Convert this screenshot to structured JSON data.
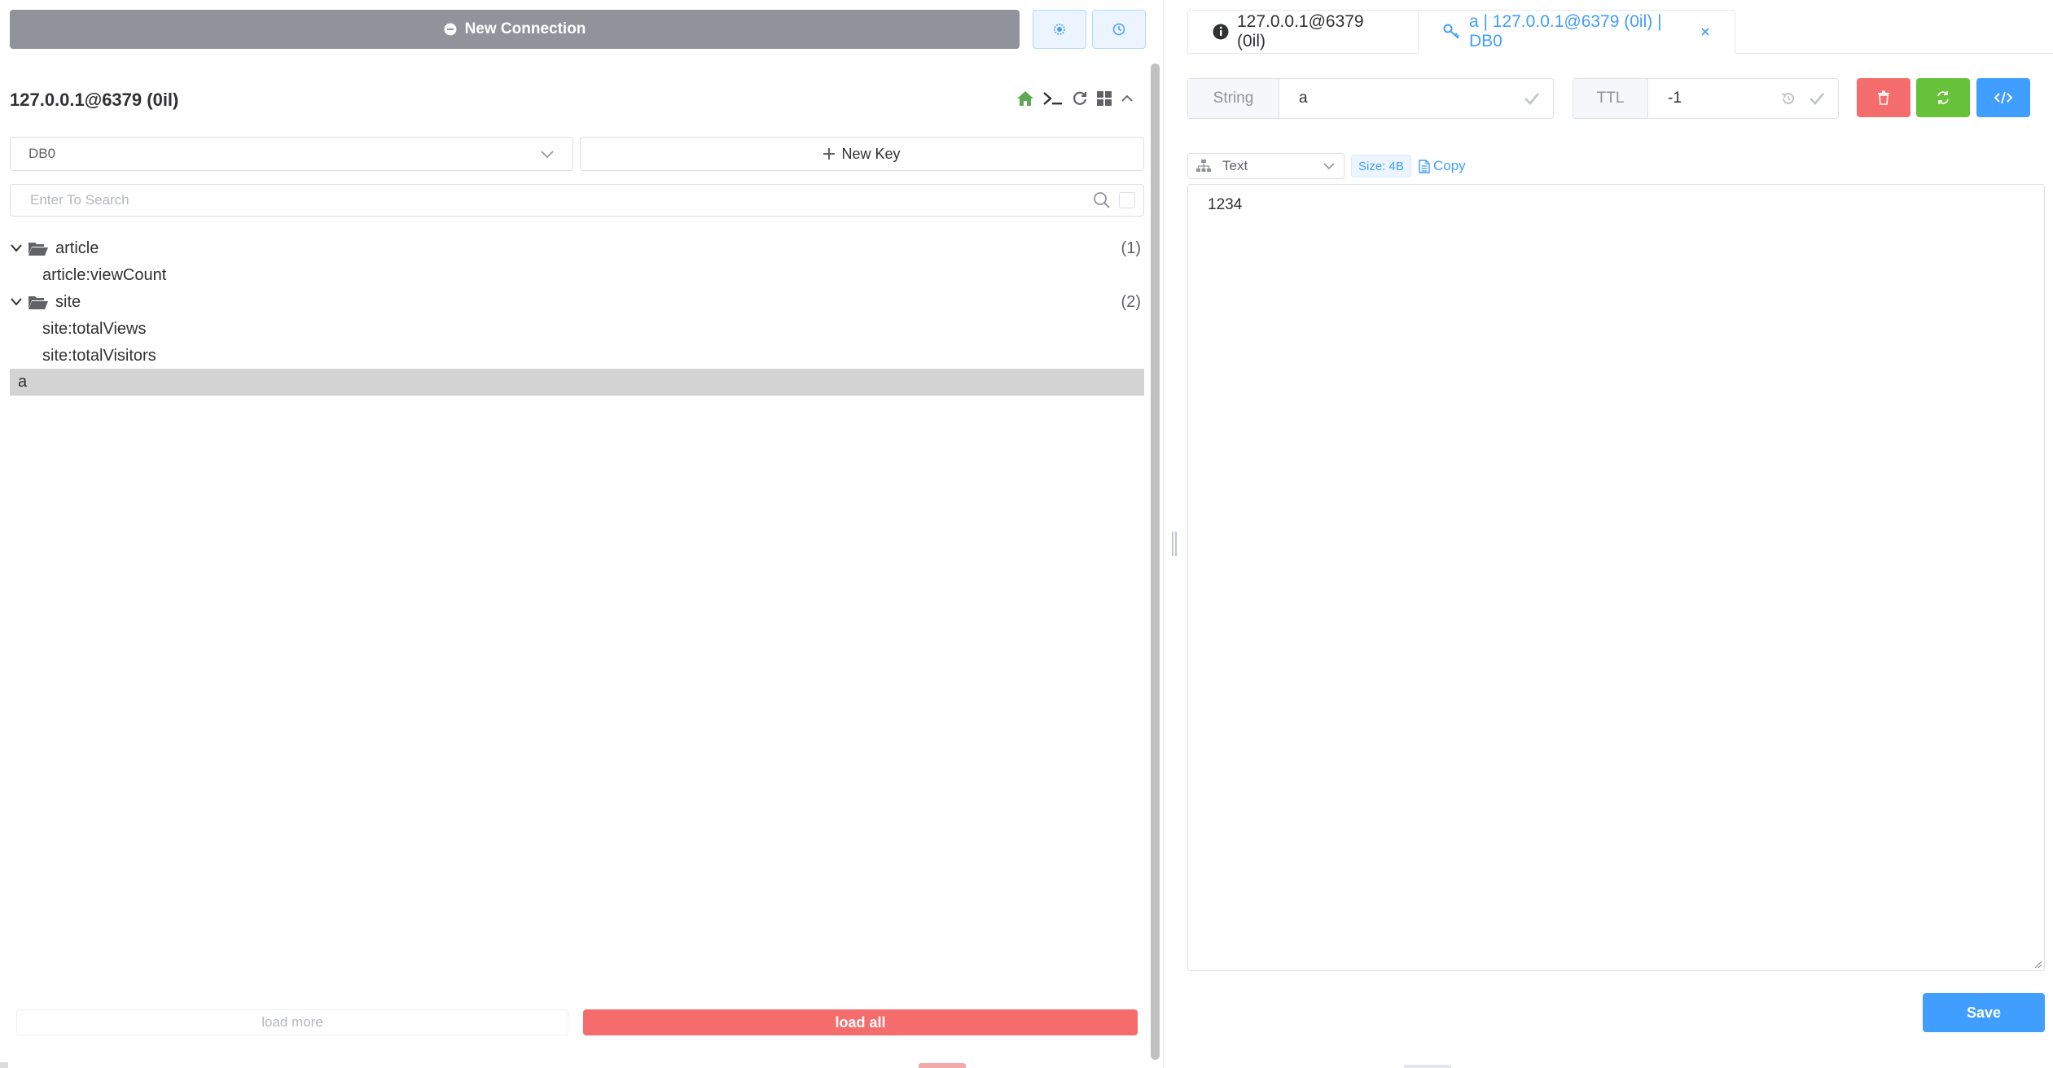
{
  "left": {
    "new_connection_label": "New Connection",
    "connection_title": "127.0.0.1@6379 (0il)",
    "db_select_value": "DB0",
    "new_key_label": "New Key",
    "search_placeholder": "Enter To Search",
    "tree": [
      {
        "folder": "article",
        "count": "(1)",
        "children": [
          "article:viewCount"
        ]
      },
      {
        "folder": "site",
        "count": "(2)",
        "children": [
          "site:totalViews",
          "site:totalVisitors"
        ]
      }
    ],
    "selected_key": "a",
    "load_more_label": "load more",
    "load_all_label": "load all"
  },
  "tabs": [
    {
      "label": "127.0.0.1@6379 (0il)"
    },
    {
      "label": "a | 127.0.0.1@6379 (0il) | DB0"
    }
  ],
  "key_detail": {
    "type_label": "String",
    "key_name": "a",
    "ttl_label": "TTL",
    "ttl_value": "-1",
    "format_value": "Text",
    "size_label": "Size: 4B",
    "copy_label": "Copy",
    "value": "1234",
    "save_label": "Save"
  },
  "colors": {
    "primary": "#409eff",
    "danger": "#f56c6c",
    "success": "#67c23a",
    "info": "#909399",
    "home_icon": "#5fa855"
  }
}
